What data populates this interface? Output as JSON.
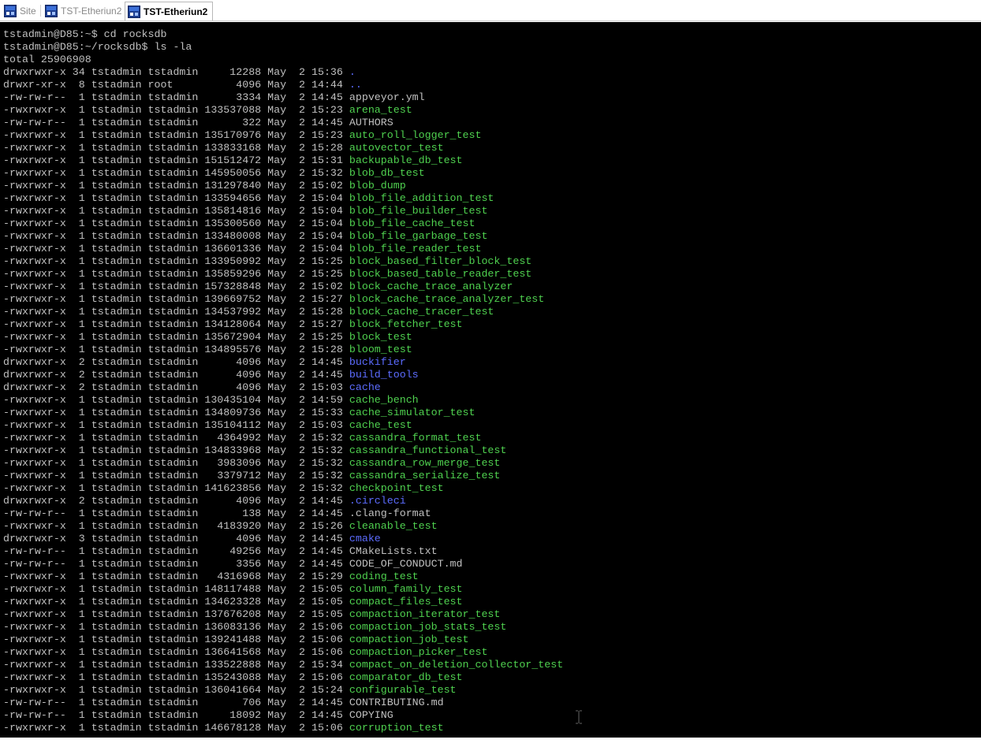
{
  "tabs": [
    {
      "label": "Site",
      "active": false,
      "icon": "terminal-session-icon"
    },
    {
      "label": "TST-Etheriun2",
      "active": false,
      "icon": "terminal-session-icon"
    },
    {
      "label": "TST-Etheriun2",
      "active": true,
      "icon": "terminal-session-icon"
    }
  ],
  "colors": {
    "background": "#000000",
    "text": "#c0c0c0",
    "executable": "#4fd14f",
    "directory": "#5c6cff"
  },
  "terminal": {
    "prompt_lines": [
      "tstadmin@D85:~$ cd rocksdb",
      "tstadmin@D85:~/rocksdb$ ls -la",
      "total 25906908"
    ],
    "entries": [
      {
        "meta": "drwxrwxr-x 34 tstadmin tstadmin     12288 May  2 15:36 ",
        "name": ".",
        "kind": "dir"
      },
      {
        "meta": "drwxr-xr-x  8 tstadmin root          4096 May  2 14:44 ",
        "name": "..",
        "kind": "dir"
      },
      {
        "meta": "-rw-rw-r--  1 tstadmin tstadmin      3334 May  2 14:45 ",
        "name": "appveyor.yml",
        "kind": "file"
      },
      {
        "meta": "-rwxrwxr-x  1 tstadmin tstadmin 133537088 May  2 15:23 ",
        "name": "arena_test",
        "kind": "exec"
      },
      {
        "meta": "-rw-rw-r--  1 tstadmin tstadmin       322 May  2 14:45 ",
        "name": "AUTHORS",
        "kind": "file"
      },
      {
        "meta": "-rwxrwxr-x  1 tstadmin tstadmin 135170976 May  2 15:23 ",
        "name": "auto_roll_logger_test",
        "kind": "exec"
      },
      {
        "meta": "-rwxrwxr-x  1 tstadmin tstadmin 133833168 May  2 15:28 ",
        "name": "autovector_test",
        "kind": "exec"
      },
      {
        "meta": "-rwxrwxr-x  1 tstadmin tstadmin 151512472 May  2 15:31 ",
        "name": "backupable_db_test",
        "kind": "exec"
      },
      {
        "meta": "-rwxrwxr-x  1 tstadmin tstadmin 145950056 May  2 15:32 ",
        "name": "blob_db_test",
        "kind": "exec"
      },
      {
        "meta": "-rwxrwxr-x  1 tstadmin tstadmin 131297840 May  2 15:02 ",
        "name": "blob_dump",
        "kind": "exec"
      },
      {
        "meta": "-rwxrwxr-x  1 tstadmin tstadmin 133594656 May  2 15:04 ",
        "name": "blob_file_addition_test",
        "kind": "exec"
      },
      {
        "meta": "-rwxrwxr-x  1 tstadmin tstadmin 135814816 May  2 15:04 ",
        "name": "blob_file_builder_test",
        "kind": "exec"
      },
      {
        "meta": "-rwxrwxr-x  1 tstadmin tstadmin 135300560 May  2 15:04 ",
        "name": "blob_file_cache_test",
        "kind": "exec"
      },
      {
        "meta": "-rwxrwxr-x  1 tstadmin tstadmin 133480008 May  2 15:04 ",
        "name": "blob_file_garbage_test",
        "kind": "exec"
      },
      {
        "meta": "-rwxrwxr-x  1 tstadmin tstadmin 136601336 May  2 15:04 ",
        "name": "blob_file_reader_test",
        "kind": "exec"
      },
      {
        "meta": "-rwxrwxr-x  1 tstadmin tstadmin 133950992 May  2 15:25 ",
        "name": "block_based_filter_block_test",
        "kind": "exec"
      },
      {
        "meta": "-rwxrwxr-x  1 tstadmin tstadmin 135859296 May  2 15:25 ",
        "name": "block_based_table_reader_test",
        "kind": "exec"
      },
      {
        "meta": "-rwxrwxr-x  1 tstadmin tstadmin 157328848 May  2 15:02 ",
        "name": "block_cache_trace_analyzer",
        "kind": "exec"
      },
      {
        "meta": "-rwxrwxr-x  1 tstadmin tstadmin 139669752 May  2 15:27 ",
        "name": "block_cache_trace_analyzer_test",
        "kind": "exec"
      },
      {
        "meta": "-rwxrwxr-x  1 tstadmin tstadmin 134537992 May  2 15:28 ",
        "name": "block_cache_tracer_test",
        "kind": "exec"
      },
      {
        "meta": "-rwxrwxr-x  1 tstadmin tstadmin 134128064 May  2 15:27 ",
        "name": "block_fetcher_test",
        "kind": "exec"
      },
      {
        "meta": "-rwxrwxr-x  1 tstadmin tstadmin 135672904 May  2 15:25 ",
        "name": "block_test",
        "kind": "exec"
      },
      {
        "meta": "-rwxrwxr-x  1 tstadmin tstadmin 134895576 May  2 15:28 ",
        "name": "bloom_test",
        "kind": "exec"
      },
      {
        "meta": "drwxrwxr-x  2 tstadmin tstadmin      4096 May  2 14:45 ",
        "name": "buckifier",
        "kind": "dir"
      },
      {
        "meta": "drwxrwxr-x  2 tstadmin tstadmin      4096 May  2 14:45 ",
        "name": "build_tools",
        "kind": "dir"
      },
      {
        "meta": "drwxrwxr-x  2 tstadmin tstadmin      4096 May  2 15:03 ",
        "name": "cache",
        "kind": "dir"
      },
      {
        "meta": "-rwxrwxr-x  1 tstadmin tstadmin 130435104 May  2 14:59 ",
        "name": "cache_bench",
        "kind": "exec"
      },
      {
        "meta": "-rwxrwxr-x  1 tstadmin tstadmin 134809736 May  2 15:33 ",
        "name": "cache_simulator_test",
        "kind": "exec"
      },
      {
        "meta": "-rwxrwxr-x  1 tstadmin tstadmin 135104112 May  2 15:03 ",
        "name": "cache_test",
        "kind": "exec"
      },
      {
        "meta": "-rwxrwxr-x  1 tstadmin tstadmin   4364992 May  2 15:32 ",
        "name": "cassandra_format_test",
        "kind": "exec"
      },
      {
        "meta": "-rwxrwxr-x  1 tstadmin tstadmin 134833968 May  2 15:32 ",
        "name": "cassandra_functional_test",
        "kind": "exec"
      },
      {
        "meta": "-rwxrwxr-x  1 tstadmin tstadmin   3983096 May  2 15:32 ",
        "name": "cassandra_row_merge_test",
        "kind": "exec"
      },
      {
        "meta": "-rwxrwxr-x  1 tstadmin tstadmin   3379712 May  2 15:32 ",
        "name": "cassandra_serialize_test",
        "kind": "exec"
      },
      {
        "meta": "-rwxrwxr-x  1 tstadmin tstadmin 141623856 May  2 15:32 ",
        "name": "checkpoint_test",
        "kind": "exec"
      },
      {
        "meta": "drwxrwxr-x  2 tstadmin tstadmin      4096 May  2 14:45 ",
        "name": ".circleci",
        "kind": "dir"
      },
      {
        "meta": "-rw-rw-r--  1 tstadmin tstadmin       138 May  2 14:45 ",
        "name": ".clang-format",
        "kind": "file"
      },
      {
        "meta": "-rwxrwxr-x  1 tstadmin tstadmin   4183920 May  2 15:26 ",
        "name": "cleanable_test",
        "kind": "exec"
      },
      {
        "meta": "drwxrwxr-x  3 tstadmin tstadmin      4096 May  2 14:45 ",
        "name": "cmake",
        "kind": "dir"
      },
      {
        "meta": "-rw-rw-r--  1 tstadmin tstadmin     49256 May  2 14:45 ",
        "name": "CMakeLists.txt",
        "kind": "file"
      },
      {
        "meta": "-rw-rw-r--  1 tstadmin tstadmin      3356 May  2 14:45 ",
        "name": "CODE_OF_CONDUCT.md",
        "kind": "file"
      },
      {
        "meta": "-rwxrwxr-x  1 tstadmin tstadmin   4316968 May  2 15:29 ",
        "name": "coding_test",
        "kind": "exec"
      },
      {
        "meta": "-rwxrwxr-x  1 tstadmin tstadmin 148117488 May  2 15:05 ",
        "name": "column_family_test",
        "kind": "exec"
      },
      {
        "meta": "-rwxrwxr-x  1 tstadmin tstadmin 134623328 May  2 15:05 ",
        "name": "compact_files_test",
        "kind": "exec"
      },
      {
        "meta": "-rwxrwxr-x  1 tstadmin tstadmin 137676208 May  2 15:05 ",
        "name": "compaction_iterator_test",
        "kind": "exec"
      },
      {
        "meta": "-rwxrwxr-x  1 tstadmin tstadmin 136083136 May  2 15:06 ",
        "name": "compaction_job_stats_test",
        "kind": "exec"
      },
      {
        "meta": "-rwxrwxr-x  1 tstadmin tstadmin 139241488 May  2 15:06 ",
        "name": "compaction_job_test",
        "kind": "exec"
      },
      {
        "meta": "-rwxrwxr-x  1 tstadmin tstadmin 136641568 May  2 15:06 ",
        "name": "compaction_picker_test",
        "kind": "exec"
      },
      {
        "meta": "-rwxrwxr-x  1 tstadmin tstadmin 133522888 May  2 15:34 ",
        "name": "compact_on_deletion_collector_test",
        "kind": "exec"
      },
      {
        "meta": "-rwxrwxr-x  1 tstadmin tstadmin 135243088 May  2 15:06 ",
        "name": "comparator_db_test",
        "kind": "exec"
      },
      {
        "meta": "-rwxrwxr-x  1 tstadmin tstadmin 136041664 May  2 15:24 ",
        "name": "configurable_test",
        "kind": "exec"
      },
      {
        "meta": "-rw-rw-r--  1 tstadmin tstadmin       706 May  2 14:45 ",
        "name": "CONTRIBUTING.md",
        "kind": "file"
      },
      {
        "meta": "-rw-rw-r--  1 tstadmin tstadmin     18092 May  2 14:45 ",
        "name": "COPYING",
        "kind": "file"
      },
      {
        "meta": "-rwxrwxr-x  1 tstadmin tstadmin 146678128 May  2 15:06 ",
        "name": "corruption_test",
        "kind": "exec"
      }
    ]
  }
}
